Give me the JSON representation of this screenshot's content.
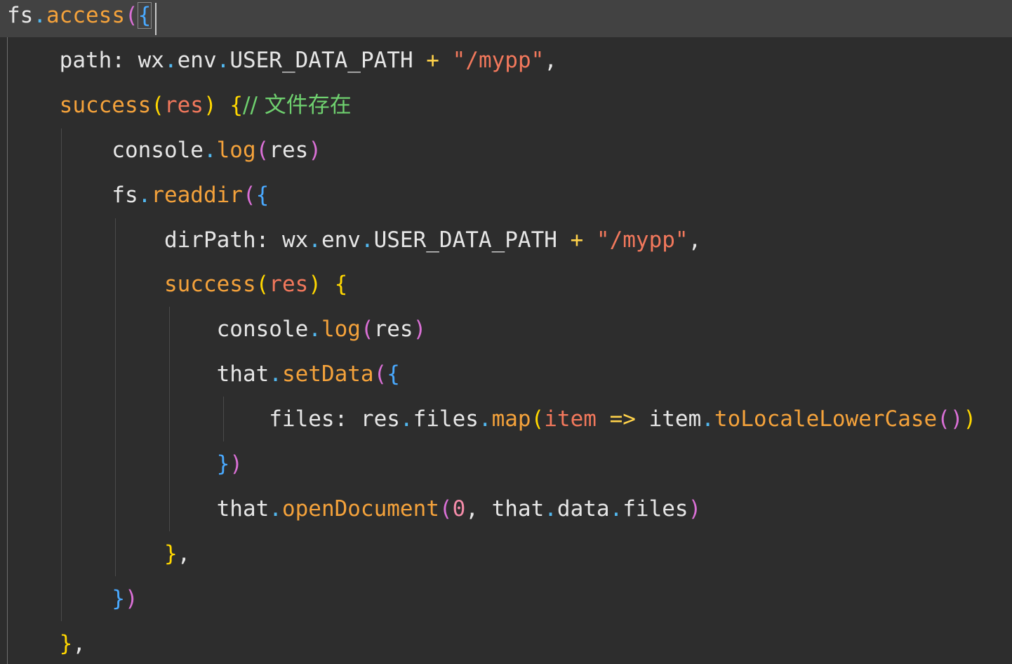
{
  "editor": {
    "language": "javascript",
    "theme": {
      "background": "#2d2d2d",
      "current_line_background": "#424242",
      "identifier": "#e6e6e6",
      "function": "#f4a23b",
      "parameter_string": "#f2785c",
      "operator": "#ffd24a",
      "property_access_dot": "#52b8f0",
      "bracket_level_1": "#ffd700",
      "bracket_level_2": "#da70d6",
      "bracket_level_3": "#49a9ff",
      "comment": "#6fd16f"
    },
    "lines": [
      {
        "tokens": [
          {
            "text": "fs",
            "type": "id"
          },
          {
            "text": ".",
            "type": "dot"
          },
          {
            "text": "access",
            "type": "fn"
          },
          {
            "text": "(",
            "type": "p2"
          },
          {
            "text": "{",
            "type": "p3",
            "boxed": true
          }
        ]
      },
      {
        "tokens": [
          {
            "text": "    path",
            "type": "id"
          },
          {
            "text": ": ",
            "type": "punc"
          },
          {
            "text": "wx",
            "type": "id"
          },
          {
            "text": ".",
            "type": "dot"
          },
          {
            "text": "env",
            "type": "id"
          },
          {
            "text": ".",
            "type": "dot"
          },
          {
            "text": "USER_DATA_PATH ",
            "type": "id"
          },
          {
            "text": "+",
            "type": "op"
          },
          {
            "text": " ",
            "type": "punc"
          },
          {
            "text": "\"/mypp\"",
            "type": "str"
          },
          {
            "text": ",",
            "type": "punc"
          }
        ]
      },
      {
        "tokens": [
          {
            "text": "    ",
            "type": "punc"
          },
          {
            "text": "success",
            "type": "fn"
          },
          {
            "text": "(",
            "type": "p1"
          },
          {
            "text": "res",
            "type": "param"
          },
          {
            "text": ")",
            "type": "p1"
          },
          {
            "text": " ",
            "type": "punc"
          },
          {
            "text": "{",
            "type": "p1"
          },
          {
            "text": "// 文件存在",
            "type": "cmt"
          }
        ]
      },
      {
        "tokens": [
          {
            "text": "        console",
            "type": "id"
          },
          {
            "text": ".",
            "type": "dot"
          },
          {
            "text": "log",
            "type": "fn"
          },
          {
            "text": "(",
            "type": "p2"
          },
          {
            "text": "res",
            "type": "id"
          },
          {
            "text": ")",
            "type": "p2"
          }
        ]
      },
      {
        "tokens": [
          {
            "text": "        fs",
            "type": "id"
          },
          {
            "text": ".",
            "type": "dot"
          },
          {
            "text": "readdir",
            "type": "fn"
          },
          {
            "text": "(",
            "type": "p2"
          },
          {
            "text": "{",
            "type": "p3"
          }
        ]
      },
      {
        "tokens": [
          {
            "text": "            dirPath",
            "type": "id"
          },
          {
            "text": ": ",
            "type": "punc"
          },
          {
            "text": "wx",
            "type": "id"
          },
          {
            "text": ".",
            "type": "dot"
          },
          {
            "text": "env",
            "type": "id"
          },
          {
            "text": ".",
            "type": "dot"
          },
          {
            "text": "USER_DATA_PATH ",
            "type": "id"
          },
          {
            "text": "+",
            "type": "op"
          },
          {
            "text": " ",
            "type": "punc"
          },
          {
            "text": "\"/mypp\"",
            "type": "str"
          },
          {
            "text": ",",
            "type": "punc"
          }
        ]
      },
      {
        "tokens": [
          {
            "text": "            ",
            "type": "punc"
          },
          {
            "text": "success",
            "type": "fn"
          },
          {
            "text": "(",
            "type": "p1"
          },
          {
            "text": "res",
            "type": "param"
          },
          {
            "text": ")",
            "type": "p1"
          },
          {
            "text": " ",
            "type": "punc"
          },
          {
            "text": "{",
            "type": "p1"
          }
        ]
      },
      {
        "tokens": [
          {
            "text": "                console",
            "type": "id"
          },
          {
            "text": ".",
            "type": "dot"
          },
          {
            "text": "log",
            "type": "fn"
          },
          {
            "text": "(",
            "type": "p2"
          },
          {
            "text": "res",
            "type": "id"
          },
          {
            "text": ")",
            "type": "p2"
          }
        ]
      },
      {
        "tokens": [
          {
            "text": "                that",
            "type": "id"
          },
          {
            "text": ".",
            "type": "dot"
          },
          {
            "text": "setData",
            "type": "fn"
          },
          {
            "text": "(",
            "type": "p2"
          },
          {
            "text": "{",
            "type": "p3"
          }
        ]
      },
      {
        "tokens": [
          {
            "text": "                    files",
            "type": "id"
          },
          {
            "text": ": ",
            "type": "punc"
          },
          {
            "text": "res",
            "type": "id"
          },
          {
            "text": ".",
            "type": "dot"
          },
          {
            "text": "files",
            "type": "id"
          },
          {
            "text": ".",
            "type": "dot"
          },
          {
            "text": "map",
            "type": "fn"
          },
          {
            "text": "(",
            "type": "p1"
          },
          {
            "text": "item",
            "type": "param"
          },
          {
            "text": " ",
            "type": "punc"
          },
          {
            "text": "=>",
            "type": "op"
          },
          {
            "text": " item",
            "type": "id"
          },
          {
            "text": ".",
            "type": "dot"
          },
          {
            "text": "toLocaleLowerCase",
            "type": "fn"
          },
          {
            "text": "(",
            "type": "p2"
          },
          {
            "text": ")",
            "type": "p2"
          },
          {
            "text": ")",
            "type": "p1"
          }
        ]
      },
      {
        "tokens": [
          {
            "text": "                ",
            "type": "punc"
          },
          {
            "text": "}",
            "type": "p3"
          },
          {
            "text": ")",
            "type": "p2"
          }
        ]
      },
      {
        "tokens": [
          {
            "text": "                that",
            "type": "id"
          },
          {
            "text": ".",
            "type": "dot"
          },
          {
            "text": "openDocument",
            "type": "fn"
          },
          {
            "text": "(",
            "type": "p2"
          },
          {
            "text": "0",
            "type": "num"
          },
          {
            "text": ", ",
            "type": "punc"
          },
          {
            "text": "that",
            "type": "id"
          },
          {
            "text": ".",
            "type": "dot"
          },
          {
            "text": "data",
            "type": "id"
          },
          {
            "text": ".",
            "type": "dot"
          },
          {
            "text": "files",
            "type": "id"
          },
          {
            "text": ")",
            "type": "p2"
          }
        ]
      },
      {
        "tokens": [
          {
            "text": "            ",
            "type": "punc"
          },
          {
            "text": "}",
            "type": "p1"
          },
          {
            "text": ",",
            "type": "punc"
          }
        ]
      },
      {
        "tokens": [
          {
            "text": "        ",
            "type": "punc"
          },
          {
            "text": "}",
            "type": "p3"
          },
          {
            "text": ")",
            "type": "p2"
          }
        ]
      },
      {
        "tokens": [
          {
            "text": "    ",
            "type": "punc"
          },
          {
            "text": "}",
            "type": "p1"
          },
          {
            "text": ",",
            "type": "punc"
          }
        ]
      }
    ]
  }
}
